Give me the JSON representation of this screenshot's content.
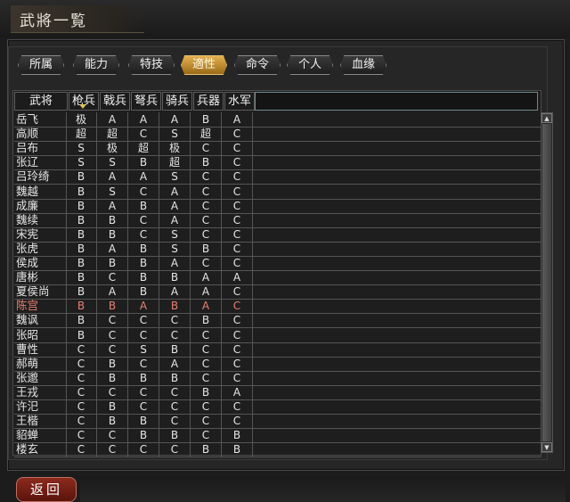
{
  "window": {
    "title": "武將一覧"
  },
  "tabs": [
    {
      "label": "所属"
    },
    {
      "label": "能力"
    },
    {
      "label": "特技"
    },
    {
      "label": "適性",
      "active": true
    },
    {
      "label": "命令"
    },
    {
      "label": "个人"
    },
    {
      "label": "血缘"
    }
  ],
  "table": {
    "headers": [
      "武将",
      "枪兵",
      "戟兵",
      "弩兵",
      "骑兵",
      "兵器",
      "水军"
    ],
    "rows": [
      [
        "岳飞",
        "极",
        "A",
        "A",
        "A",
        "B",
        "A"
      ],
      [
        "高顺",
        "超",
        "超",
        "C",
        "S",
        "超",
        "C"
      ],
      [
        "吕布",
        "S",
        "极",
        "超",
        "极",
        "C",
        "C"
      ],
      [
        "张辽",
        "S",
        "S",
        "B",
        "超",
        "B",
        "C"
      ],
      [
        "吕玲绮",
        "B",
        "A",
        "A",
        "S",
        "C",
        "C"
      ],
      [
        "魏越",
        "B",
        "S",
        "C",
        "A",
        "C",
        "C"
      ],
      [
        "成廉",
        "B",
        "A",
        "B",
        "A",
        "C",
        "C"
      ],
      [
        "魏续",
        "B",
        "B",
        "C",
        "A",
        "C",
        "C"
      ],
      [
        "宋宪",
        "B",
        "B",
        "C",
        "S",
        "C",
        "C"
      ],
      [
        "张虎",
        "B",
        "A",
        "B",
        "S",
        "B",
        "C"
      ],
      [
        "侯成",
        "B",
        "B",
        "B",
        "A",
        "C",
        "C"
      ],
      [
        "唐彬",
        "B",
        "C",
        "B",
        "B",
        "A",
        "A"
      ],
      [
        "夏侯尚",
        "B",
        "A",
        "B",
        "A",
        "A",
        "C"
      ],
      [
        "陈宫",
        "B",
        "B",
        "A",
        "B",
        "A",
        "C"
      ],
      [
        "魏讽",
        "B",
        "C",
        "C",
        "C",
        "B",
        "C"
      ],
      [
        "张昭",
        "B",
        "C",
        "C",
        "C",
        "C",
        "C"
      ],
      [
        "曹性",
        "C",
        "C",
        "S",
        "B",
        "C",
        "C"
      ],
      [
        "郝萌",
        "C",
        "B",
        "C",
        "A",
        "C",
        "C"
      ],
      [
        "张邈",
        "C",
        "B",
        "B",
        "B",
        "C",
        "C"
      ],
      [
        "王戎",
        "C",
        "C",
        "C",
        "C",
        "B",
        "A"
      ],
      [
        "许汜",
        "C",
        "B",
        "C",
        "C",
        "C",
        "C"
      ],
      [
        "王楷",
        "C",
        "B",
        "B",
        "C",
        "C",
        "C"
      ],
      [
        "貂蝉",
        "C",
        "C",
        "B",
        "B",
        "C",
        "B"
      ],
      [
        "楼玄",
        "C",
        "C",
        "C",
        "C",
        "B",
        "B"
      ]
    ],
    "highlight_row": 13,
    "highlight_color": "#e88070"
  },
  "footer": {
    "back_label": "返回"
  },
  "colors": {
    "accent": "#c8902a",
    "panel": "#262626"
  }
}
